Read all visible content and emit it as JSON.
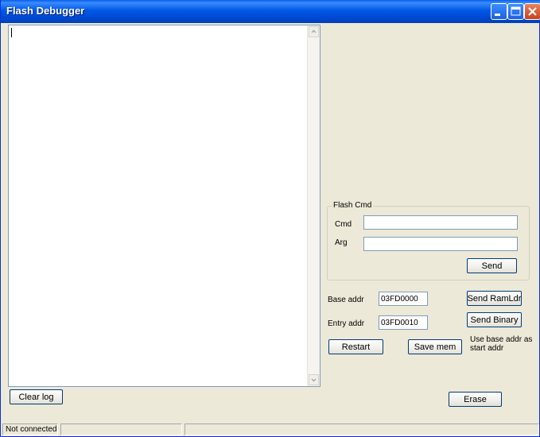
{
  "window": {
    "title": "Flash Debugger"
  },
  "log": {
    "clear_label": "Clear log"
  },
  "flash_cmd": {
    "legend": "Flash Cmd",
    "cmd_label": "Cmd",
    "cmd_value": "",
    "arg_label": "Arg",
    "arg_value": "",
    "send_label": "Send"
  },
  "ramldr": {
    "base_label": "Base addr",
    "base_value": "03FD0000",
    "entry_label": "Entry addr",
    "entry_value": "03FD0010",
    "send_ramldr_label": "Send RamLdr",
    "send_binary_label": "Send Binary",
    "restart_label": "Restart",
    "save_mem_label": "Save mem",
    "use_base_note": "Use base addr as start addr"
  },
  "erase_label": "Erase",
  "status": {
    "connection": "Not connected",
    "pane2": "",
    "pane3": ""
  }
}
